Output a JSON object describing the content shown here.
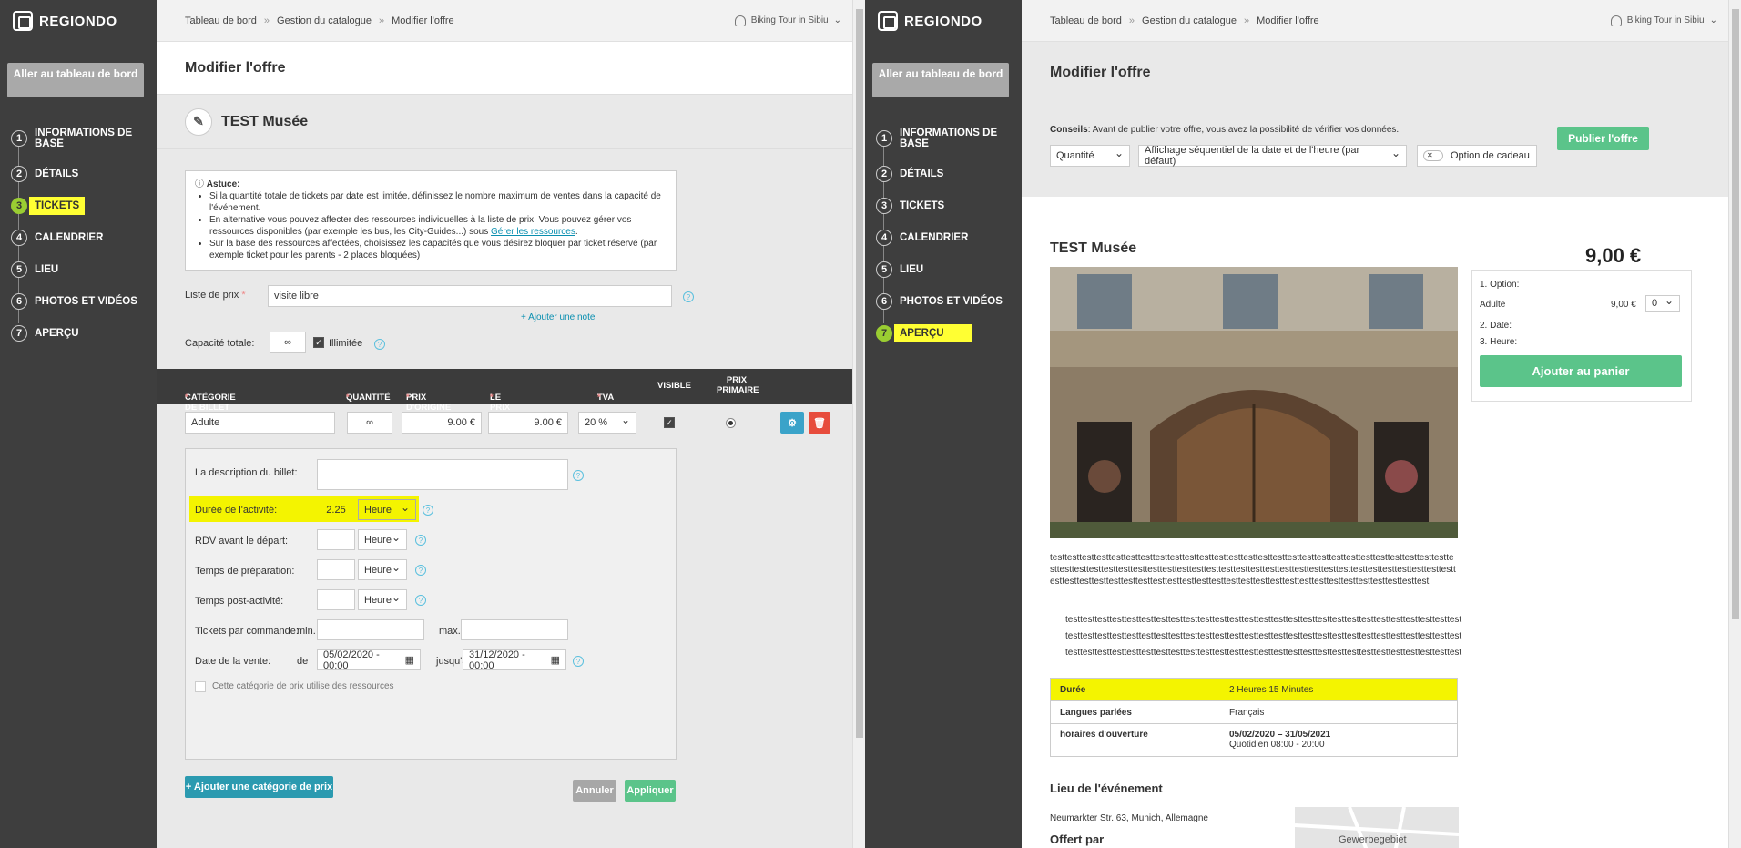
{
  "brand": "REGIONDO",
  "sidebar": {
    "dashboard_button": "Aller au tableau de bord",
    "items": [
      {
        "n": "1",
        "label": "INFORMATIONS DE BASE"
      },
      {
        "n": "2",
        "label": "DÉTAILS"
      },
      {
        "n": "3",
        "label": "TICKETS"
      },
      {
        "n": "4",
        "label": "CALENDRIER"
      },
      {
        "n": "5",
        "label": "LIEU"
      },
      {
        "n": "6",
        "label": "PHOTOS ET VIDÉOS"
      },
      {
        "n": "7",
        "label": "APERÇU"
      }
    ]
  },
  "breadcrumb": [
    "Tableau de bord",
    "Gestion du catalogue",
    "Modifier l'offre"
  ],
  "breadcrumb_sep": "»",
  "user": "Biking Tour in Sibiu",
  "page_title": "Modifier l'offre",
  "offer_name": "TEST Musée",
  "tip": {
    "title": "Astuce:",
    "items": [
      "Si la quantité totale de tickets par date est limitée, définissez le nombre maximum de ventes dans la capacité de l'événement.",
      "En alternative vous pouvez affecter des ressources individuelles à la liste de prix. Vous pouvez gérer vos ressources disponibles (par exemple les bus, les City-Guides...) sous",
      "Sur la base des ressources affectées, choisissez les capacités que vous désirez bloquer par ticket réservé (par exemple ticket pour les parents - 2 places bloquées)"
    ],
    "link": "Gérer les ressources",
    "link_suffix": "."
  },
  "price_list": {
    "label": "Liste de prix",
    "value": "visite libre",
    "add_note": "+ Ajouter une note"
  },
  "capacity": {
    "label": "Capacité totale:",
    "value": "∞",
    "unlimited": "Illimitée"
  },
  "columns": [
    "CATÉGORIE DE BILLET",
    "QUANTITÉ",
    "PRIX D'ORIGINE",
    "LE PRIX EN LIGNE",
    "TVA",
    "VISIBLE",
    "PRIX PRIMAIRE"
  ],
  "ticket": {
    "category": "Adulte",
    "quantity": "∞",
    "orig_price": "9.00 €",
    "online_price": "9.00 €",
    "vat": "20 %"
  },
  "details": {
    "desc_label": "La description du billet:",
    "duration_label": "Durée de l'activité:",
    "duration_value": "2.25",
    "unit": "Heure",
    "rdv_label": "RDV avant le départ:",
    "prep_label": "Temps de préparation:",
    "post_label": "Temps post-activité:",
    "per_order_label": "Tickets par commande:",
    "min": "min.",
    "max": "max.",
    "sale_label": "Date de la vente:",
    "from": "de",
    "from_date": "05/02/2020 - 00:00",
    "until": "jusqu'à",
    "until_date": "31/12/2020 - 00:00",
    "resources": "Cette catégorie de prix utilise des ressources"
  },
  "actions": {
    "add_category": "+ Ajouter une catégorie de prix",
    "cancel": "Annuler",
    "apply": "Appliquer"
  },
  "preview": {
    "tips_bold": "Conseils",
    "tips": ": Avant de publier votre offre, vous avez la possibilité de vérifier vos données.",
    "select1": "Quantité",
    "select2": "Affichage séquentiel de la date et de l'heure (par défaut)",
    "gift": "Option de cadeau",
    "publish": "Publier l'offre",
    "title": "TEST Musée",
    "price": "9,00 €",
    "opt1": "1. Option:",
    "adult": "Adulte",
    "adult_price": "9,00 €",
    "qty": "0",
    "opt2": "2. Date:",
    "opt3": "3. Heure:",
    "add_cart": "Ajouter au panier",
    "desc": "testtesttesttesttesttesttesttesttesttesttesttesttesttesttesttesttesttesttesttesttesttesttesttesttesttesttesttesttesttesttesttesttesttesttesttesttesttesttesttesttesttesttesttesttesttesttesttesttesttesttesttesttesttesttesttesttesttesttesttesttesttesttesttesttesttesttesttesttesttesttesttesttesttesttesttesttesttesttesttesttest",
    "bullets": [
      "testtesttesttesttesttesttesttesttesttesttesttesttesttesttesttesttesttesttesttesttesttesttesttesttesttesttest",
      "testtesttesttesttesttesttesttesttesttesttesttesttesttesttesttesttesttesttesttesttesttesttesttesttesttesttest",
      "testtesttesttesttesttesttesttesttesttesttesttesttesttesttesttesttesttesttesttesttesttesttesttesttesttesttest"
    ],
    "rows": [
      {
        "k": "Durée",
        "v": "2 Heures 15 Minutes"
      },
      {
        "k": "Langues parlées",
        "v": "Français"
      },
      {
        "k": "horaires d'ouverture",
        "v": "05/02/2020 – 31/05/2021",
        "v2": "Quotidien   08:00 - 20:00"
      }
    ],
    "venue_title": "Lieu de l'événement",
    "address": "Neumarkter Str. 63, Munich, Allemagne",
    "offered": "Offert par",
    "map_label": "Gewerbegebiet"
  }
}
